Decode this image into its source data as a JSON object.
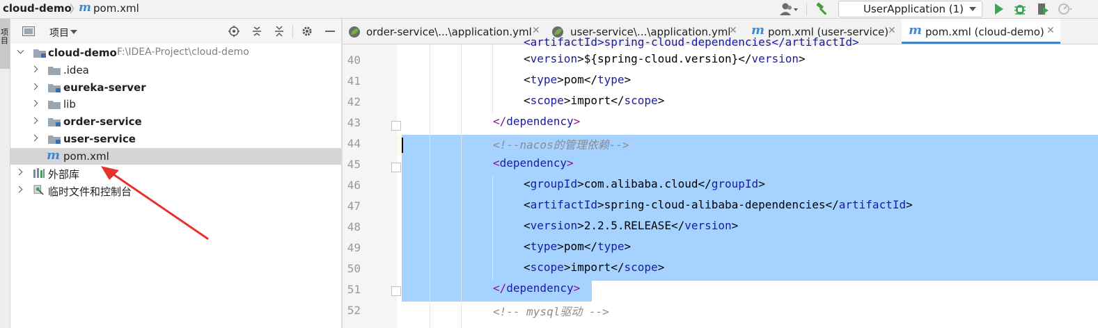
{
  "breadcrumb": {
    "project": "cloud-demo",
    "separator": "〉",
    "file": "pom.xml"
  },
  "toolbar": {
    "run_config": "UserApplication (1)"
  },
  "left_strip": {
    "label": "项目"
  },
  "project_panel": {
    "title": "项目",
    "tree": [
      {
        "label": "cloud-demo",
        "path": "F:\\IDEA-Project\\cloud-demo"
      },
      {
        "label": ".idea"
      },
      {
        "label": "eureka-server"
      },
      {
        "label": "lib"
      },
      {
        "label": "order-service"
      },
      {
        "label": "user-service"
      },
      {
        "label": "pom.xml"
      },
      {
        "label": "外部库"
      },
      {
        "label": "临时文件和控制台"
      }
    ]
  },
  "tabs": [
    {
      "label": "order-service\\...\\application.yml",
      "icon": "spring-leaf-icon"
    },
    {
      "label": "user-service\\...\\application.yml",
      "icon": "spring-leaf-icon"
    },
    {
      "label": "pom.xml (user-service)",
      "icon": "maven-m-icon"
    },
    {
      "label": "pom.xml (cloud-demo)",
      "icon": "maven-m-icon",
      "active": true
    }
  ],
  "editor": {
    "lines": [
      {
        "n": "40",
        "open": "version",
        "text": "${spring-cloud.version}",
        "close": "version"
      },
      {
        "n": "41",
        "open": "type",
        "text": "pom",
        "close": "type"
      },
      {
        "n": "42",
        "open": "scope",
        "text": "import",
        "close": "scope"
      },
      {
        "n": "43",
        "endtag": "dependency"
      },
      {
        "n": "44",
        "comment": "<!--nacos的管理依赖-->"
      },
      {
        "n": "45",
        "opentag": "dependency"
      },
      {
        "n": "46",
        "open": "groupId",
        "text": "com.alibaba.cloud",
        "close": "groupId"
      },
      {
        "n": "47",
        "open": "artifactId",
        "text": "spring-cloud-alibaba-dependencies",
        "close": "artifactId"
      },
      {
        "n": "48",
        "open": "version",
        "text": "2.2.5.RELEASE",
        "close": "version"
      },
      {
        "n": "49",
        "open": "type",
        "text": "pom",
        "close": "type"
      },
      {
        "n": "50",
        "open": "scope",
        "text": "import",
        "close": "scope"
      },
      {
        "n": "51",
        "endtag": "dependency"
      },
      {
        "n": "52",
        "comment": "<!-- mysql驱动 -->"
      }
    ],
    "partial_top_line": "<artifactId>spring-cloud-dependencies</artifactId>"
  },
  "colors": {
    "selection": "#a6d2ff",
    "tag": "#1a1aa6",
    "comment": "#8c8c8c",
    "accent": "#4083c9",
    "annotation_arrow": "#e8312b"
  }
}
